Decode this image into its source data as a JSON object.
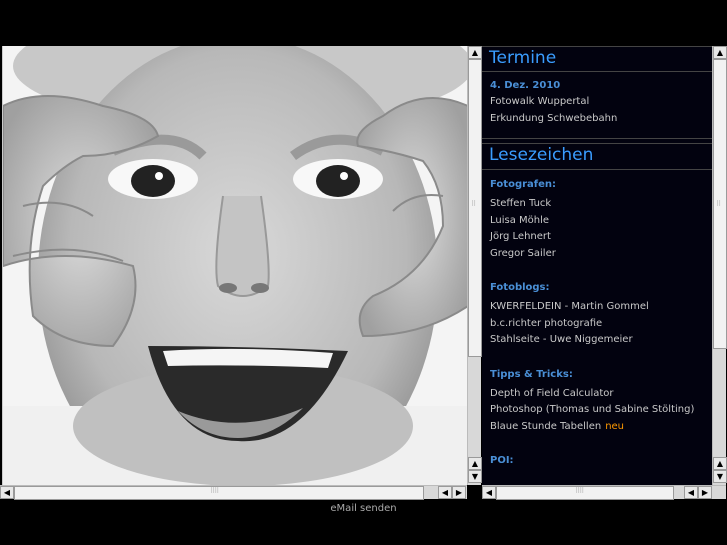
{
  "termine": {
    "title": "Termine",
    "date": "4. Dez. 2010",
    "items": [
      "Fotowalk Wuppertal",
      "Erkundung Schwebebahn"
    ]
  },
  "lesezeichen": {
    "title": "Lesezeichen",
    "fotografen": {
      "heading": "Fotografen:",
      "items": [
        "Steffen Tuck",
        "Luisa Möhle",
        "Jörg Lehnert",
        "Gregor Sailer"
      ]
    },
    "fotoblogs": {
      "heading": "Fotoblogs:",
      "items": [
        "KWERFELDEIN - Martin Gommel",
        "b.c.richter photografie",
        "Stahlseite - Uwe Niggemeier"
      ]
    },
    "tipps": {
      "heading": "Tipps & Tricks:",
      "items": [
        "Depth of Field Calculator",
        "Photoshop (Thomas und Sabine Stölting)",
        "Blaue Stunde Tabellen"
      ],
      "new_badge": "neu"
    },
    "poi": {
      "heading": "POI:"
    }
  },
  "footer": {
    "email_link": "eMail senden"
  },
  "icons": {
    "up": "arrow-up-icon",
    "down": "arrow-down-icon",
    "left": "arrow-left-icon",
    "right": "arrow-right-icon"
  },
  "colors": {
    "accent": "#3a9dff",
    "subheading": "#4a8fd6",
    "new_badge": "#ff9900",
    "panel_bg": "#02020f"
  }
}
